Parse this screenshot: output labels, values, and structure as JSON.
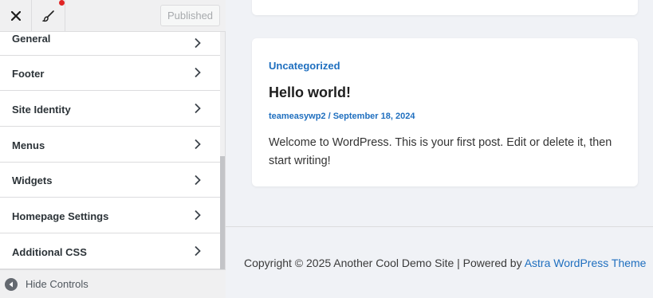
{
  "topbar": {
    "publish_label": "Published"
  },
  "panel": {
    "items": [
      {
        "label": "General"
      },
      {
        "label": "Footer"
      },
      {
        "label": "Site Identity"
      },
      {
        "label": "Menus"
      },
      {
        "label": "Widgets"
      },
      {
        "label": "Homepage Settings"
      },
      {
        "label": "Additional CSS"
      }
    ]
  },
  "controls": {
    "hide_label": "Hide Controls"
  },
  "post": {
    "category": "Uncategorized",
    "title": "Hello world!",
    "meta": "teameasywp2 / September 18, 2024",
    "excerpt": "Welcome to WordPress. This is your first post. Edit or delete it, then start writing!"
  },
  "footer": {
    "copyright": "Copyright © 2025 Another Cool Demo Site | Powered by ",
    "link": "Astra WordPress Theme"
  },
  "colors": {
    "accent": "#1f6fbf",
    "notification_dot": "#e02424"
  }
}
